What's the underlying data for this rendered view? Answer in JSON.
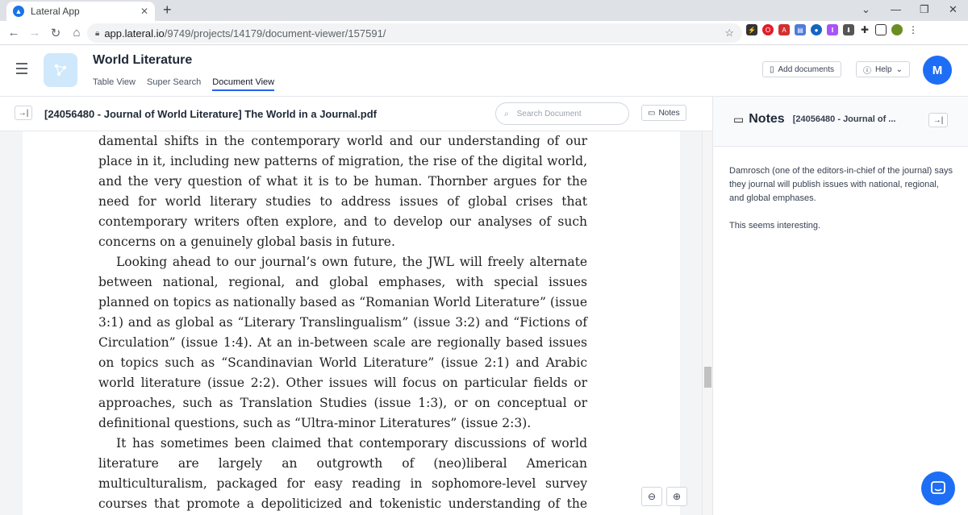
{
  "browser": {
    "tab_title": "Lateral App",
    "url_host": "app.lateral.io",
    "url_path": "/9749/projects/14179/document-viewer/157591/"
  },
  "app": {
    "title": "World Literature",
    "tabs": [
      {
        "label": "Table View"
      },
      {
        "label": "Super Search"
      },
      {
        "label": "Document View",
        "active": true
      }
    ],
    "add_documents_label": "Add documents",
    "help_label": "Help",
    "avatar_initial": "M",
    "accent_color": "#1d6ef5"
  },
  "document": {
    "title": "[24056480 - Journal of World Literature] The World in a Journal.pdf",
    "search_placeholder": "Search Document",
    "notes_button_label": "Notes",
    "paragraphs": [
      "damental shifts in the contemporary world and our understanding of our place in it, including new patterns of migration, the rise of the digital world, and the very question of what it is to be human. Thornber argues for the need for world literary studies to address issues of global crises that contemporary writers often explore, and to develop our analyses of such concerns on a genuinely global basis in future.",
      "Looking ahead to our journal’s own future, the JWL will freely alternate between national, regional, and global emphases, with special issues planned on topics as nationally based as “Romanian World Literature” (issue 3:1) and as global as “Literary Translingualism” (issue 3:2) and “Fictions of Circulation” (issue 1:4). At an in-between scale are regionally based issues on topics such as “Scandinavian World Literature” (issue 2:1) and Arabic world literature (issue 2:2). Other issues will focus on particular fields or approaches, such as Translation Studies (issue 1:3), or on conceptual or definitional questions, such as “Ultra-minor Literatures” (issue 2:3).",
      "It has sometimes been claimed that contemporary discussions of world literature are largely an outgrowth of (neo)liberal American multiculturalism, packaged for easy reading in sophomore-level survey courses that promote a depoliticized and tokenistic understanding of the wider world, superficially"
    ]
  },
  "notes": {
    "label": "Notes",
    "doc_short": "[24056480 - Journal of ...",
    "items": [
      "Damrosch (one of the editors-in-chief of the journal) says they journal will publish issues with national, regional, and global emphases.",
      "This seems interesting."
    ]
  }
}
